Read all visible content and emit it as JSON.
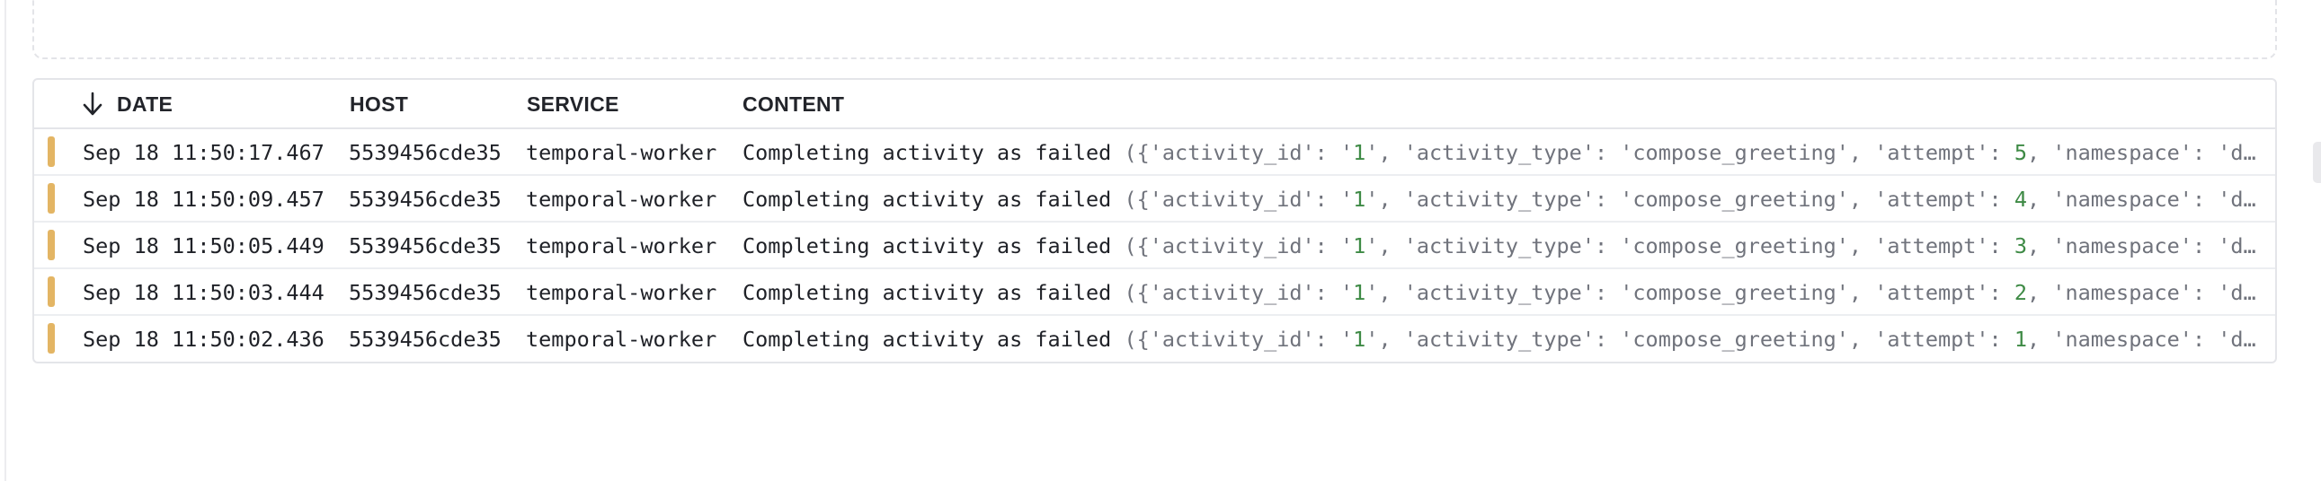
{
  "columns": {
    "date": "DATE",
    "host": "HOST",
    "service": "SERVICE",
    "content": "CONTENT"
  },
  "sort_icon": "arrow-down-icon",
  "colors": {
    "level_warning": "#e3b564",
    "attr_text": "#70737c",
    "number_value": "#3e8a45"
  },
  "rows": [
    {
      "date": "Sep 18 11:50:17.467",
      "host": "5539456cde35",
      "service": "temporal-worker",
      "message": "Completing activity as failed",
      "attrs_a": " ({'activity_id': '",
      "id_value": "1",
      "attrs_b": "', 'activity_type': 'compose_greeting', 'attempt': ",
      "attempt": "5",
      "attrs_c": ", 'namespace': 'd…"
    },
    {
      "date": "Sep 18 11:50:09.457",
      "host": "5539456cde35",
      "service": "temporal-worker",
      "message": "Completing activity as failed",
      "attrs_a": " ({'activity_id': '",
      "id_value": "1",
      "attrs_b": "', 'activity_type': 'compose_greeting', 'attempt': ",
      "attempt": "4",
      "attrs_c": ", 'namespace': 'd…"
    },
    {
      "date": "Sep 18 11:50:05.449",
      "host": "5539456cde35",
      "service": "temporal-worker",
      "message": "Completing activity as failed",
      "attrs_a": " ({'activity_id': '",
      "id_value": "1",
      "attrs_b": "', 'activity_type': 'compose_greeting', 'attempt': ",
      "attempt": "3",
      "attrs_c": ", 'namespace': 'd…"
    },
    {
      "date": "Sep 18 11:50:03.444",
      "host": "5539456cde35",
      "service": "temporal-worker",
      "message": "Completing activity as failed",
      "attrs_a": " ({'activity_id': '",
      "id_value": "1",
      "attrs_b": "', 'activity_type': 'compose_greeting', 'attempt': ",
      "attempt": "2",
      "attrs_c": ", 'namespace': 'd…"
    },
    {
      "date": "Sep 18 11:50:02.436",
      "host": "5539456cde35",
      "service": "temporal-worker",
      "message": "Completing activity as failed",
      "attrs_a": " ({'activity_id': '",
      "id_value": "1",
      "attrs_b": "', 'activity_type': 'compose_greeting', 'attempt': ",
      "attempt": "1",
      "attrs_c": ", 'namespace': 'd…"
    }
  ]
}
